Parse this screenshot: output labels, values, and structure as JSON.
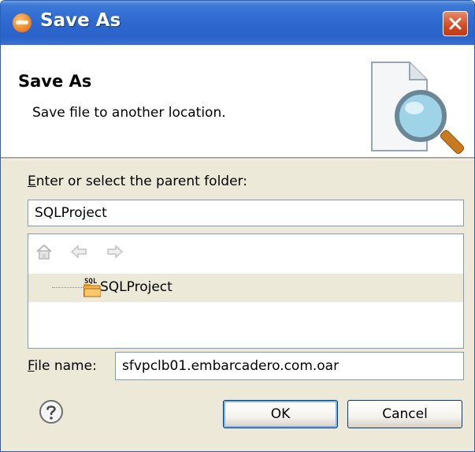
{
  "window": {
    "title": "Save As",
    "icon": "eclipse-app-icon",
    "close_icon": "close-icon"
  },
  "banner": {
    "title": "Save As",
    "description": "Save file to another location.",
    "icon": "document-search-icon"
  },
  "parent_folder": {
    "label_mnemonic": "E",
    "label_rest": "nter or select the parent folder:",
    "value": "SQLProject"
  },
  "tree": {
    "toolbar": [
      "home-icon",
      "back-arrow-icon",
      "forward-arrow-icon"
    ],
    "items": [
      {
        "label": "SQLProject",
        "icon": "sql-project-folder-icon",
        "icon_text": "SQL"
      }
    ]
  },
  "file_name": {
    "label_mnemonic": "F",
    "label_rest": "ile name:",
    "value": "sfvpclb01.embarcadero.com.oar"
  },
  "buttons": {
    "ok": "OK",
    "cancel": "Cancel",
    "help_icon": "help-icon"
  },
  "colors": {
    "titlebar": "#2f6ad0",
    "close_button": "#d24a23",
    "dialog_bg": "#ece9d8",
    "input_border": "#7f9db9"
  }
}
